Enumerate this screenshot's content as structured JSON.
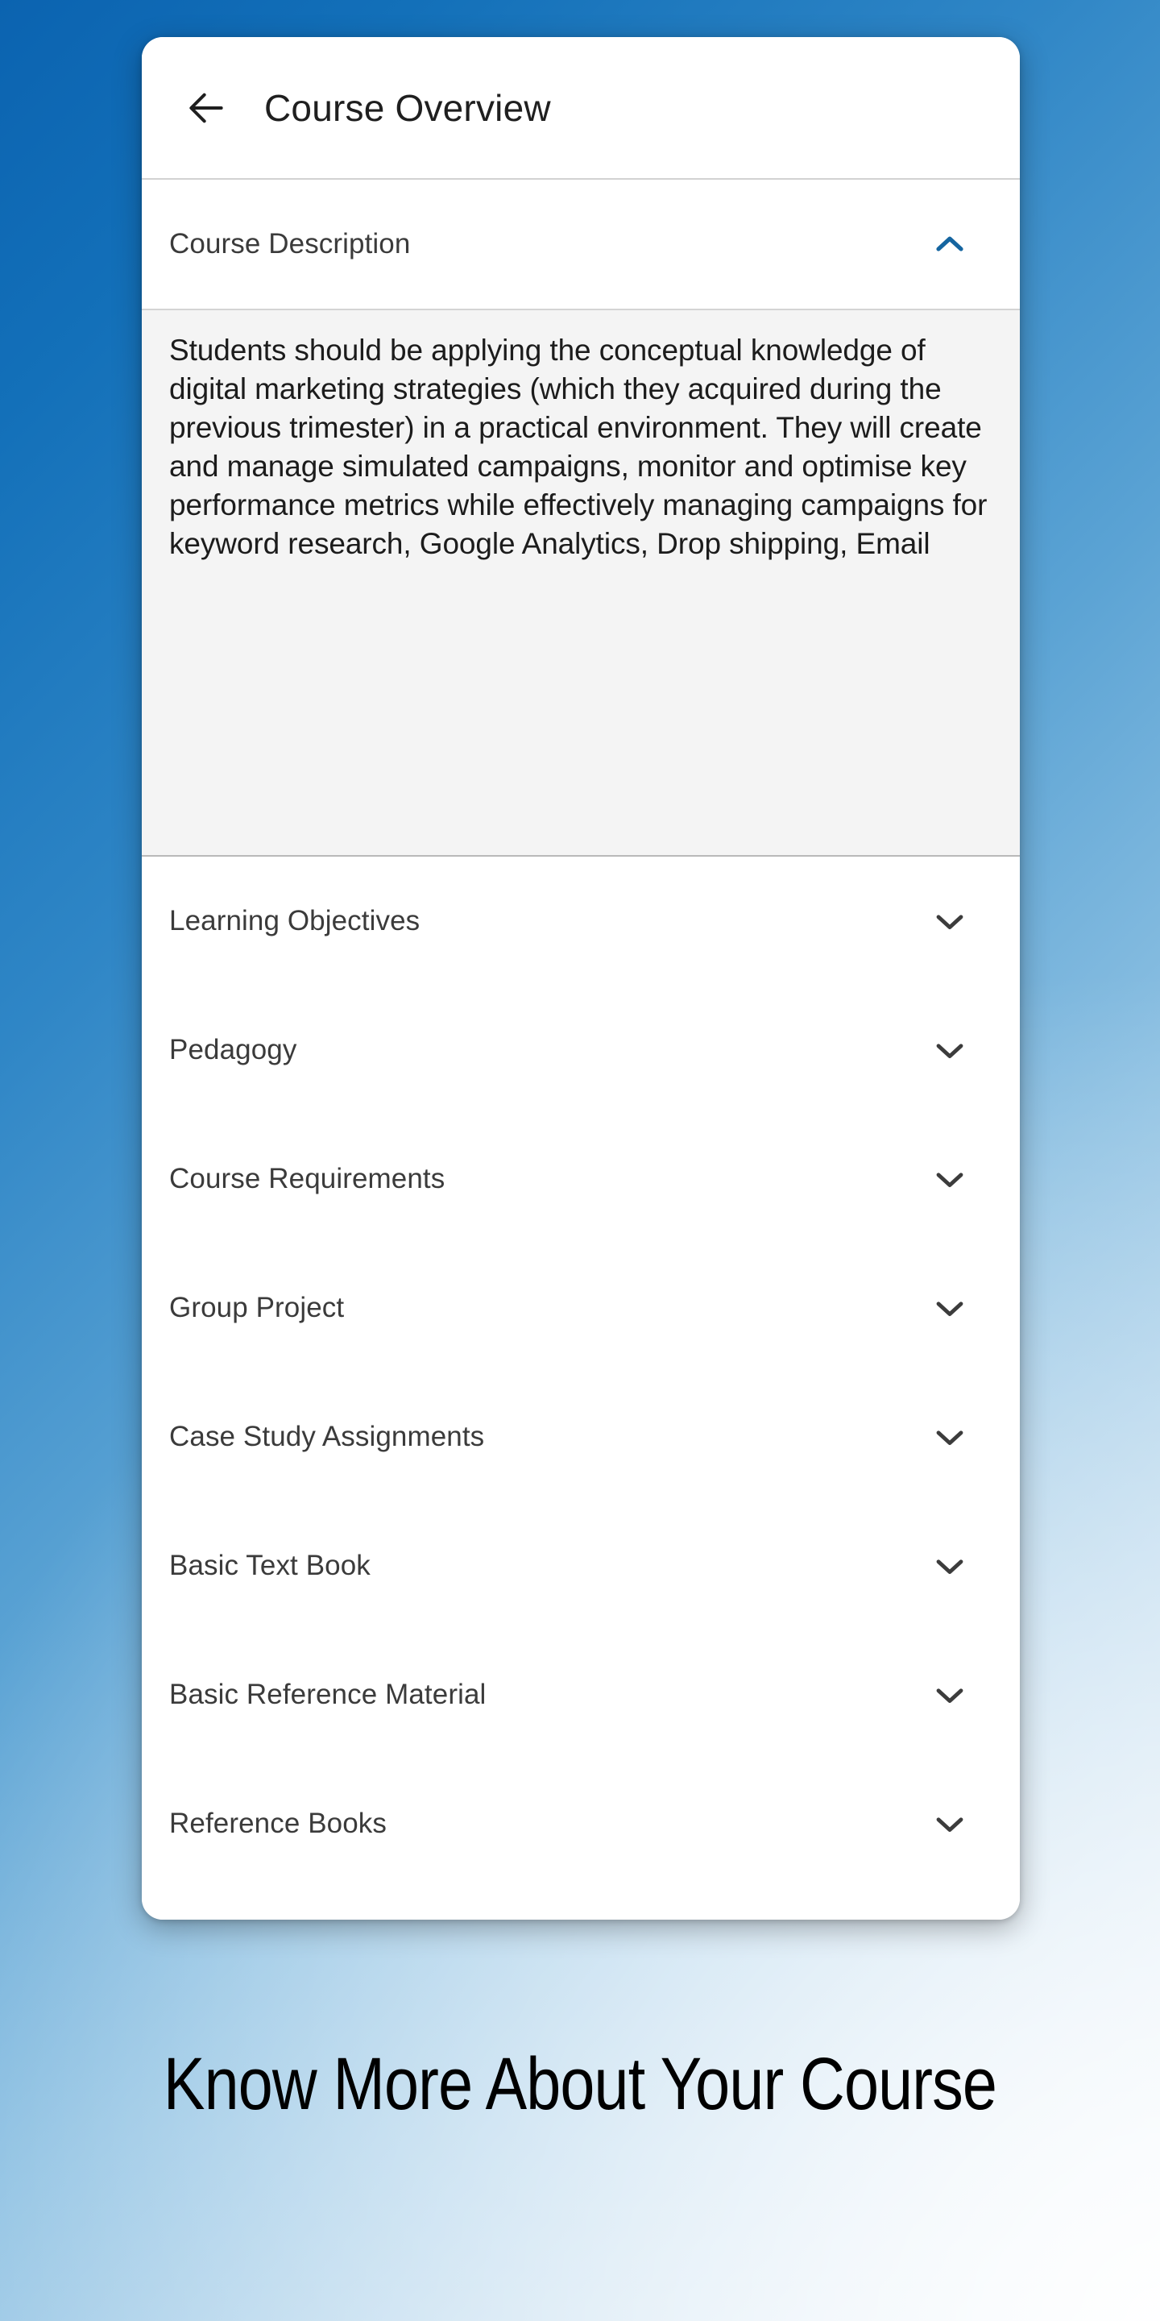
{
  "appbar": {
    "back_icon": "arrow-left-icon",
    "title": "Course Overview"
  },
  "accordion": {
    "expanded": {
      "label": "Course Description",
      "chevron_icon": "chevron-up-icon",
      "chevron_color": "#1565a0",
      "body": "Students should be applying the conceptual knowledge of digital marketing strategies (which they acquired during the previous trimester) in a practical environment. They will create and manage simulated campaigns, monitor and optimise key performance metrics while effectively managing campaigns for keyword research, Google Analytics, Drop shipping, Email"
    },
    "collapsed_items": [
      {
        "label": "Learning Objectives",
        "chevron_icon": "chevron-down-icon"
      },
      {
        "label": "Pedagogy",
        "chevron_icon": "chevron-down-icon"
      },
      {
        "label": "Course Requirements",
        "chevron_icon": "chevron-down-icon"
      },
      {
        "label": "Group Project",
        "chevron_icon": "chevron-down-icon"
      },
      {
        "label": "Case Study Assignments",
        "chevron_icon": "chevron-down-icon"
      },
      {
        "label": "Basic Text Book",
        "chevron_icon": "chevron-down-icon"
      },
      {
        "label": "Basic Reference Material",
        "chevron_icon": "chevron-down-icon"
      },
      {
        "label": "Reference Books",
        "chevron_icon": "chevron-down-icon"
      }
    ]
  },
  "caption": {
    "text": "Know More About Your Course"
  },
  "colors": {
    "background_start": "#0b63b0",
    "background_end": "#eef5fb",
    "card": "#ffffff",
    "body_panel": "#f4f4f4",
    "accent_blue": "#1565a0",
    "chevron_gray": "#3c3c3c",
    "title_text": "#1f1f1f",
    "row_text": "#3b3b3b"
  }
}
